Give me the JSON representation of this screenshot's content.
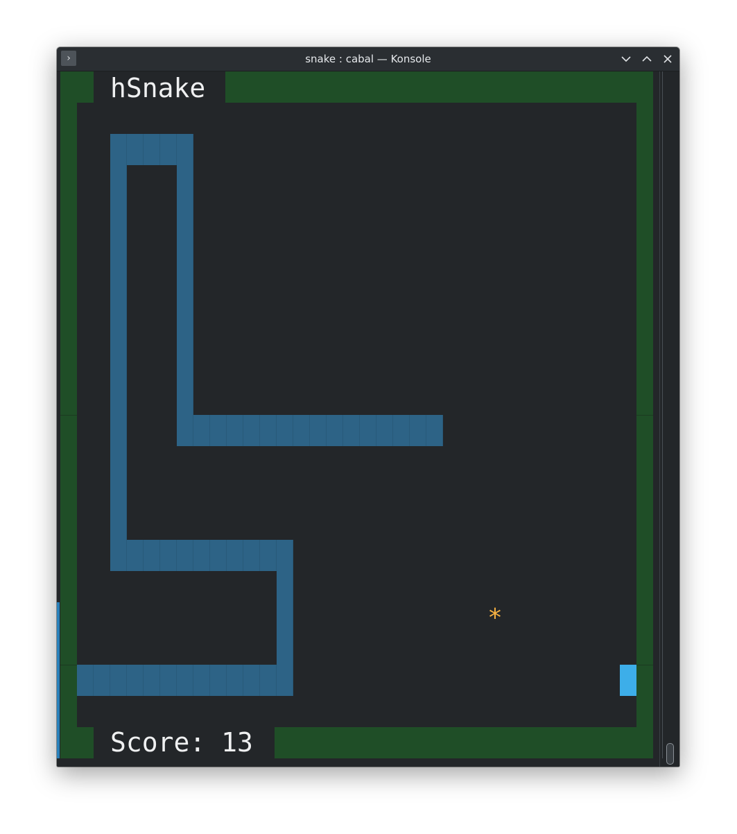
{
  "window": {
    "title": "snake : cabal — Konsole",
    "app_icon_glyph": "›"
  },
  "controls": {
    "minimize_icon": "chevron-down-icon",
    "maximize_icon": "chevron-up-icon",
    "close_icon": "close-icon"
  },
  "game": {
    "title": "hSnake",
    "score_label": "Score:",
    "score_value": "13",
    "food_glyph": "*"
  },
  "colors": {
    "wall": "#1f4e27",
    "snake": "#2d6386",
    "food": "#f5b041",
    "cursor": "#3daee9",
    "terminal_bg": "#232629"
  }
}
